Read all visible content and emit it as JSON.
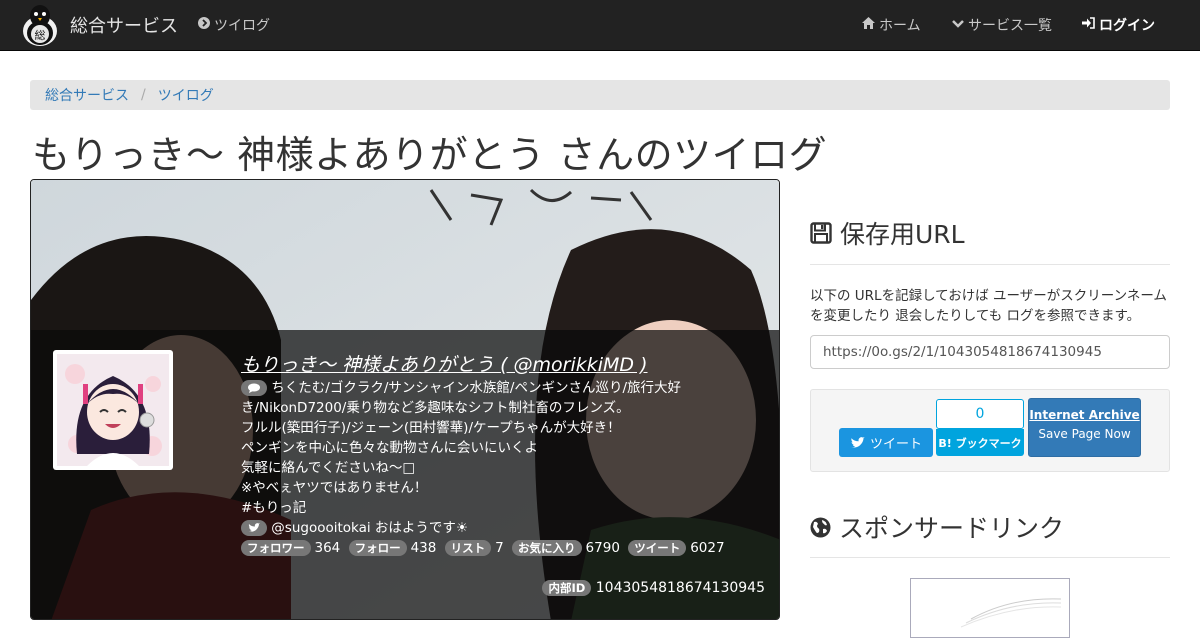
{
  "nav": {
    "brand": "総合サービス",
    "twilog": "ツイログ",
    "home": "ホーム",
    "services": "サービス一覧",
    "login": "ログイン"
  },
  "breadcrumb": [
    "総合サービス",
    "ツイログ"
  ],
  "page_title": "もりっき～ 神様よありがとう さんのツイログ",
  "profile": {
    "name_link": "もりっき～ 神様よありがとう ( @morikkiMD )",
    "bio_lines": [
      "ちくたむ/ゴクラク/サンシャイン水族館/ペンギンさん巡り/旅行大好",
      "き/NikonD7200/乗り物など多趣味なシフト制社畜のフレンズ。",
      "フルル(築田行子)/ジェーン(田村響華)/ケープちゃんが大好き！",
      "ペンギンを中心に色々な動物さんに会いにいくよ",
      "気軽に絡んでくださいね～□",
      "※やべぇヤツではありません！",
      "#もりっ記"
    ],
    "latest_tweet": "@sugoooitokai おはようです☀",
    "stats": [
      {
        "label": "フォロワー",
        "value": "364"
      },
      {
        "label": "フォロー",
        "value": "438"
      },
      {
        "label": "リスト",
        "value": "7"
      },
      {
        "label": "お気に入り",
        "value": "6790"
      },
      {
        "label": "ツイート",
        "value": "6027"
      }
    ],
    "internal_id_label": "内部ID",
    "internal_id": "1043054818674130945"
  },
  "sidebar": {
    "save_url_heading": "保存用URL",
    "save_url_desc": "以下の URLを記録しておけば ユーザーがスクリーンネームを変更したり 退会したりしても ログを参照できます。",
    "save_url_value": "https://0o.gs/2/1/1043054818674130945",
    "tweet_button": "ツイート",
    "hatena_count": "0",
    "hatena_button": "B! ブックマーク",
    "ia_title": "Internet Archive",
    "ia_sub": "Save Page Now",
    "sponsor_heading": "スポンサードリンク"
  },
  "colors": {
    "navbar_bg": "#222222",
    "link": "#337ab7",
    "twitter": "#1b95e0",
    "hatena": "#00a4de",
    "ia_button": "#337ab7"
  }
}
